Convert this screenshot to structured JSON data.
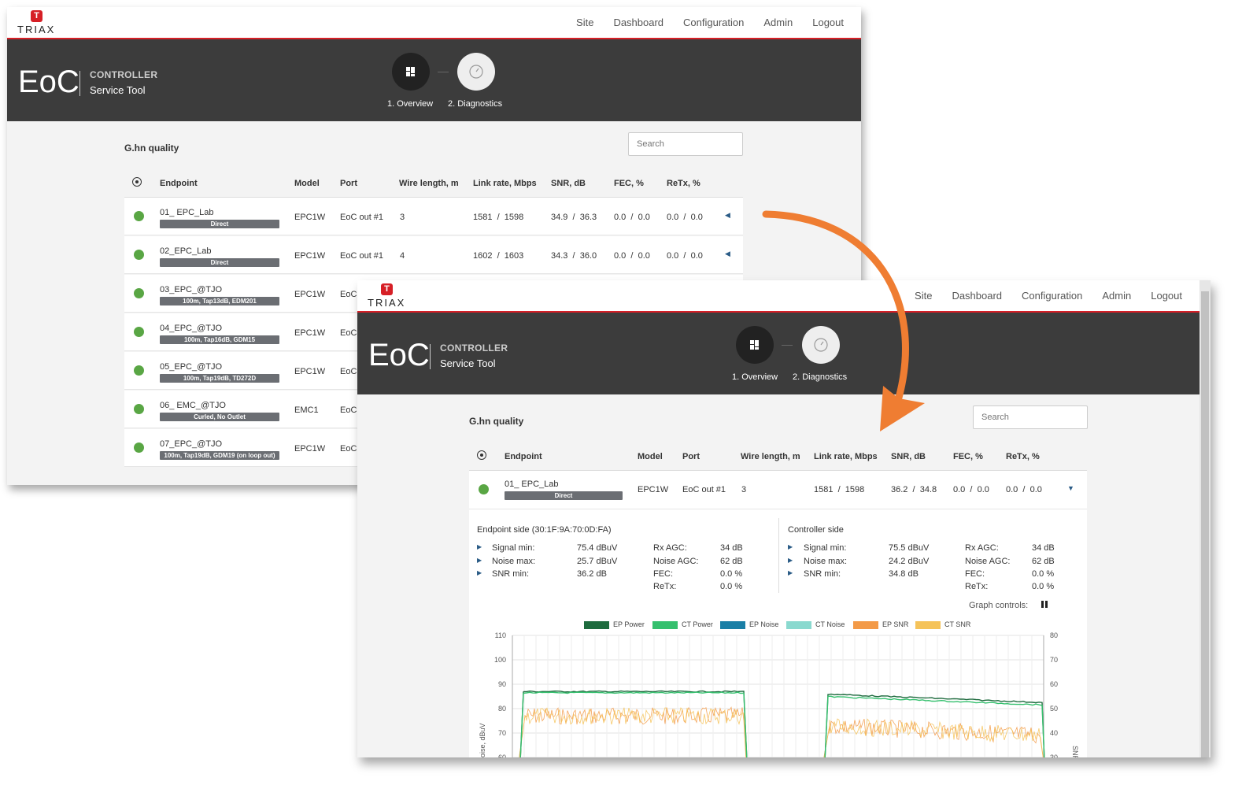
{
  "brand": {
    "logo_letter": "T",
    "logo_word": "TRIAX"
  },
  "nav": [
    "Site",
    "Dashboard",
    "Configuration",
    "Admin",
    "Logout"
  ],
  "hero": {
    "product": "EoC",
    "subtitle_top": "CONTROLLER",
    "subtitle_bottom": "Service Tool",
    "steps": [
      "1. Overview",
      "2. Diagnostics"
    ]
  },
  "section_title": "G.hn quality",
  "search": {
    "placeholder": "Search"
  },
  "columns": [
    "Endpoint",
    "Model",
    "Port",
    "Wire length, m",
    "Link rate, Mbps",
    "SNR, dB",
    "FEC, %",
    "ReTx, %"
  ],
  "separator": "/",
  "rows": [
    {
      "name": "01_ EPC_Lab",
      "tag": "Direct",
      "model": "EPC1W",
      "port": "EoC out #1",
      "wire": "3",
      "rate_a": "1581",
      "rate_b": "1598",
      "snr_a": "34.9",
      "snr_b": "36.3",
      "fec_a": "0.0",
      "fec_b": "0.0",
      "retx_a": "0.0",
      "retx_b": "0.0"
    },
    {
      "name": "02_EPC_Lab",
      "tag": "Direct",
      "model": "EPC1W",
      "port": "EoC out #1",
      "wire": "4",
      "rate_a": "1602",
      "rate_b": "1603",
      "snr_a": "34.3",
      "snr_b": "36.0",
      "fec_a": "0.0",
      "fec_b": "0.0",
      "retx_a": "0.0",
      "retx_b": "0.0"
    },
    {
      "name": "03_EPC_@TJO",
      "tag": "100m, Tap13dB, EDM201",
      "model": "EPC1W",
      "port": "EoC"
    },
    {
      "name": "04_EPC_@TJO",
      "tag": "100m, Tap16dB, GDM15",
      "model": "EPC1W",
      "port": "EoC"
    },
    {
      "name": "05_EPC_@TJO",
      "tag": "100m, Tap19dB, TD272D",
      "model": "EPC1W",
      "port": "EoC"
    },
    {
      "name": "06_ EMC_@TJO",
      "tag": "Curled, No Outlet",
      "model": "EMC1",
      "port": "EoC"
    },
    {
      "name": "07_EPC_@TJO",
      "tag": "100m, Tap19dB, GDM19 (on loop out)",
      "model": "EPC1W",
      "port": "EoC"
    }
  ],
  "expanded_row": {
    "name": "01_ EPC_Lab",
    "tag": "Direct",
    "model": "EPC1W",
    "port": "EoC out #1",
    "wire": "3",
    "rate_a": "1581",
    "rate_b": "1598",
    "snr_a": "36.2",
    "snr_b": "34.8",
    "fec_a": "0.0",
    "fec_b": "0.0",
    "retx_a": "0.0",
    "retx_b": "0.0"
  },
  "details": {
    "endpoint_title": "Endpoint side (30:1F:9A:70:0D:FA)",
    "controller_title": "Controller side",
    "endpoint": {
      "signal_label": "Signal min:",
      "signal": "75.4 dBuV",
      "noise_label": "Noise max:",
      "noise": "25.7 dBuV",
      "snr_label": "SNR min:",
      "snr": "36.2 dB",
      "rxagc_label": "Rx AGC:",
      "rxagc": "34 dB",
      "noiseagc_label": "Noise AGC:",
      "noiseagc": "62 dB",
      "fec_label": "FEC:",
      "fec": "0.0 %",
      "retx_label": "ReTx:",
      "retx": "0.0 %"
    },
    "controller": {
      "signal_label": "Signal min:",
      "signal": "75.5 dBuV",
      "noise_label": "Noise max:",
      "noise": "24.2 dBuV",
      "snr_label": "SNR min:",
      "snr": "34.8 dB",
      "rxagc_label": "Rx AGC:",
      "rxagc": "34 dB",
      "noiseagc_label": "Noise AGC:",
      "noiseagc": "62 dB",
      "fec_label": "FEC:",
      "fec": "0.0 %",
      "retx_label": "ReTx:",
      "retx": "0.0 %"
    },
    "graph_controls": "Graph controls:"
  },
  "colors": {
    "accent": "#d61f26",
    "hero_bg": "#3c3c3c",
    "status_ok": "#59a644",
    "arrow": "#ef7d32"
  },
  "chart_data": {
    "type": "line",
    "series": [
      {
        "name": "EP Power",
        "color": "#1e6b3e"
      },
      {
        "name": "CT Power",
        "color": "#35c06e"
      },
      {
        "name": "EP Noise",
        "color": "#1a7fa6"
      },
      {
        "name": "CT Noise",
        "color": "#8ad9cf"
      },
      {
        "name": "EP SNR",
        "color": "#f39a48"
      },
      {
        "name": "CT SNR",
        "color": "#f5c35a"
      }
    ],
    "left_axis": {
      "ticks": [
        110,
        100,
        90,
        80,
        70,
        60
      ],
      "label": "oise, dBuV"
    },
    "right_axis": {
      "ticks": [
        80,
        70,
        60,
        50,
        40,
        30
      ],
      "label": "SNR"
    },
    "segments": [
      {
        "ep_power": 87,
        "ct_power": 86.5,
        "snr_mid": 77
      },
      {
        "ep_power": 86,
        "ct_power": 85,
        "snr_mid": 73
      }
    ]
  }
}
